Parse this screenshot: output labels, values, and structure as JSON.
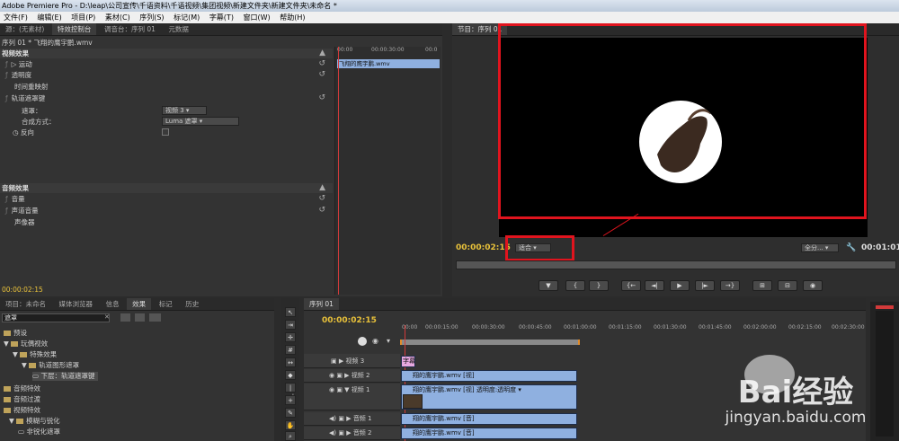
{
  "window": {
    "title": "Adobe Premiere Pro - D:\\leap\\公司宣传\\千语资料\\千语视频\\集团视频\\新建文件夹\\新建文件夹\\未命名 *"
  },
  "menu": [
    "文件(F)",
    "编辑(E)",
    "项目(P)",
    "素材(C)",
    "序列(S)",
    "标记(M)",
    "字幕(T)",
    "窗口(W)",
    "帮助(H)"
  ],
  "source_panel": {
    "tabs": [
      "源：(无素材)",
      "特效控制台",
      "调音台：序列 01",
      "元数据"
    ],
    "active_tab": 1,
    "clip_title": "序列 01 * 飞翔的鹰宇鹏.wmv",
    "mini_ruler": [
      "00:00",
      "00:00:30:00",
      "00:0"
    ],
    "mini_clip": "飞翔的鹰宇鹏.wmv",
    "rows": [
      {
        "label": "视频效果",
        "header": true
      },
      {
        "label": "运动",
        "fx": true,
        "reset": true
      },
      {
        "label": "透明度",
        "fx": true,
        "reset": true
      },
      {
        "label": "时间重映射",
        "fx": false
      },
      {
        "label": "轨道遮罩键",
        "fx": true,
        "reset": true
      },
      {
        "label": "遮罩：",
        "value": "视频 3",
        "indent": true
      },
      {
        "label": "合成方式：",
        "value": "Luma 遮罩",
        "indent": true
      },
      {
        "label": "反向",
        "indent": true,
        "checkbox": true
      },
      {
        "label": "音频效果",
        "header": true
      },
      {
        "label": "音量",
        "fx": true,
        "reset": true
      },
      {
        "label": "声道音量",
        "fx": true,
        "reset": true
      },
      {
        "label": "声像器",
        "fx": false
      }
    ],
    "timecode": "00:00:02:15"
  },
  "program_panel": {
    "tab": "节目：序列 01",
    "timecode": "00:00:02:15",
    "fit_label": "适合",
    "quality_label": "全分...",
    "duration": "00:01:01",
    "controls": [
      "▼",
      "{",
      "}",
      "{←",
      "◄|",
      "▶",
      "|►",
      "→}",
      "⊞",
      "⊟",
      "◉"
    ]
  },
  "project_panel": {
    "tabs": [
      "项目：未命名",
      "媒体浏览器",
      "信息",
      "效果",
      "标记",
      "历史"
    ],
    "active_tab": 3,
    "search_value": "遮罩",
    "tree": [
      {
        "label": "预设",
        "level": 0
      },
      {
        "label": "玩偶视效",
        "level": 0
      },
      {
        "label": "特殊效果",
        "level": 1
      },
      {
        "label": "轨道图形遮罩",
        "level": 2
      },
      {
        "label": "下层：轨道遮罩键",
        "level": 3
      },
      {
        "label": "音频特效",
        "level": 0
      },
      {
        "label": "音频过渡",
        "level": 0
      },
      {
        "label": "视频特效",
        "level": 0
      },
      {
        "label": "模糊与锐化",
        "level": 1
      },
      {
        "label": "非锐化遮罩",
        "level": 2
      }
    ]
  },
  "timeline": {
    "tab": "序列 01",
    "timecode": "00:00:02:15",
    "ruler": [
      "00:00",
      "00:00:15:00",
      "00:00:30:00",
      "00:00:45:00",
      "00:01:00:00",
      "00:01:15:00",
      "00:01:30:00",
      "00:01:45:00",
      "00:02:00:00",
      "00:02:15:00",
      "00:02:30:00"
    ],
    "tracks": [
      {
        "name": "视频 3",
        "clip": "字幕",
        "color": "#e7a8e0"
      },
      {
        "name": "视频 2",
        "clip": "翔的鹰宇鹏.wmv [视]",
        "color": "#8fb0e0"
      },
      {
        "name": "视频 1",
        "clip": "翔的鹰宇鹏.wmv [视] 透明度:透明度 ▾",
        "color": "#8fb0e0"
      },
      {
        "name": "音频 1",
        "clip": "翔的鹰宇鹏.wmv [音]",
        "color": "#8fb0e0"
      },
      {
        "name": "音频 2",
        "clip": "翔的鹰宇鹏.wmv [音]",
        "color": "#8fb0e0"
      }
    ]
  },
  "watermark": {
    "brand": "Bai经验",
    "url": "jingyan.baidu.com"
  },
  "colors": {
    "highlight_red": "#e0141e",
    "timecode_yellow": "#e8c13a",
    "clip_blue": "#8fb0e0",
    "clip_pink": "#e7a8e0"
  }
}
